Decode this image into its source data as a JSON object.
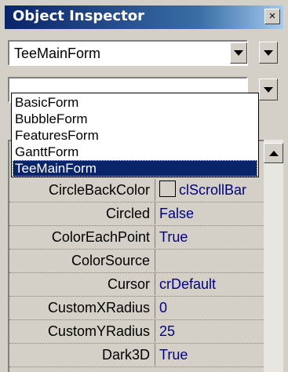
{
  "window": {
    "title": "Object Inspector",
    "close_glyph": "×"
  },
  "combo": {
    "value": "TeeMainForm"
  },
  "dropdown": {
    "items": [
      {
        "label": "BasicForm",
        "selected": false
      },
      {
        "label": "BubbleForm",
        "selected": false
      },
      {
        "label": "FeaturesForm",
        "selected": false
      },
      {
        "label": "GanttForm",
        "selected": false
      },
      {
        "label": "TeeMainForm",
        "selected": true
      }
    ]
  },
  "properties": [
    {
      "name": "CircleBackColor",
      "value": "clScrollBar",
      "swatch": true
    },
    {
      "name": "Circled",
      "value": "False"
    },
    {
      "name": "ColorEachPoint",
      "value": "True"
    },
    {
      "name": "ColorSource",
      "value": ""
    },
    {
      "name": "Cursor",
      "value": "crDefault"
    },
    {
      "name": "CustomXRadius",
      "value": "0"
    },
    {
      "name": "CustomYRadius",
      "value": "25"
    },
    {
      "name": "Dark3D",
      "value": "True"
    }
  ],
  "colors": {
    "titlebar_start": "#0a246a",
    "titlebar_end": "#a6caf0",
    "value_text": "#000080",
    "selection": "#0a246a",
    "face": "#d4d0c8"
  }
}
